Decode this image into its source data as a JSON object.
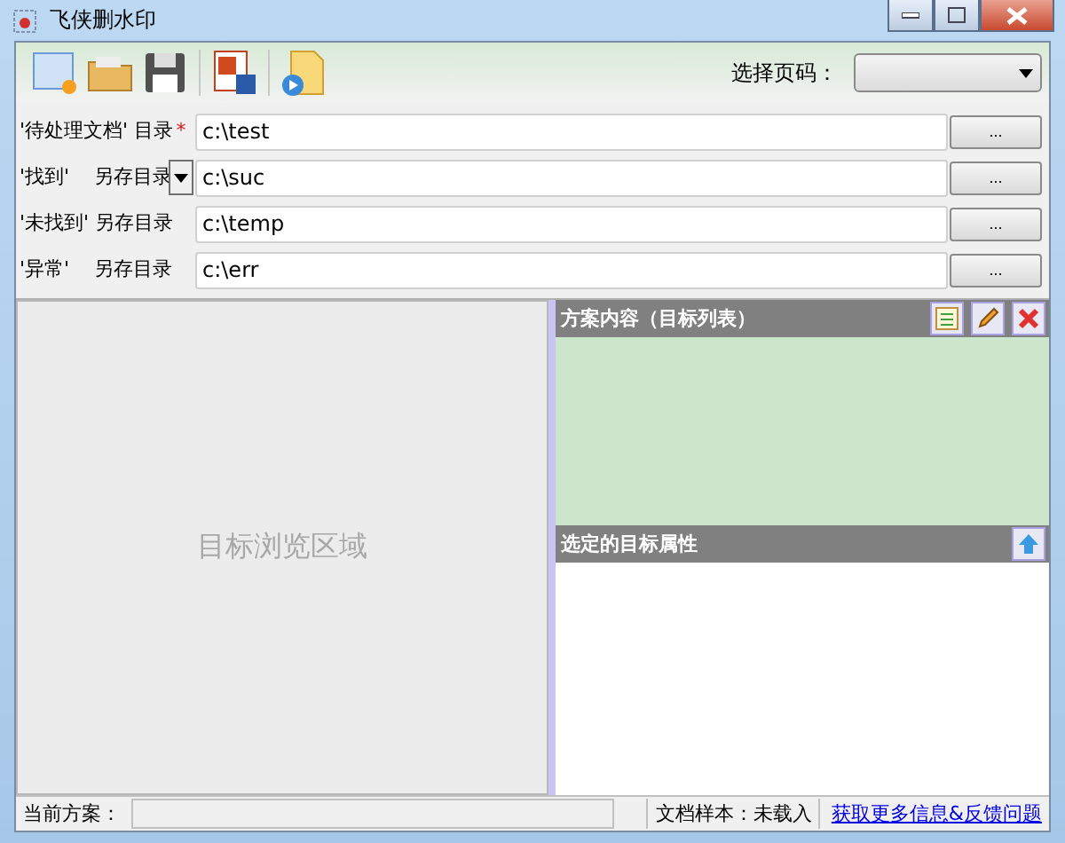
{
  "window": {
    "title": "飞侠删水印"
  },
  "toolbar": {
    "page_label": "选择页码："
  },
  "paths": [
    {
      "label": "'待处理文档' 目录",
      "required_mark": "*",
      "has_dropdown": false,
      "value": "c:\\test",
      "button": "..."
    },
    {
      "label": "'找到'    另存目录",
      "has_dropdown": true,
      "value": "c:\\suc",
      "button": "..."
    },
    {
      "label": "'未找到' 另存目录",
      "has_dropdown": false,
      "value": "c:\\temp",
      "button": "..."
    },
    {
      "label": "'异常'    另存目录",
      "has_dropdown": false,
      "value": "c:\\err",
      "button": "..."
    }
  ],
  "preview": {
    "placeholder": "目标浏览区域"
  },
  "plan_panel": {
    "title": "方案内容（目标列表）"
  },
  "props_panel": {
    "title": "选定的目标属性"
  },
  "status_bar": {
    "plan_label": "当前方案：",
    "sample": "文档样本：未载入",
    "link": "获取更多信息&反馈问题"
  }
}
